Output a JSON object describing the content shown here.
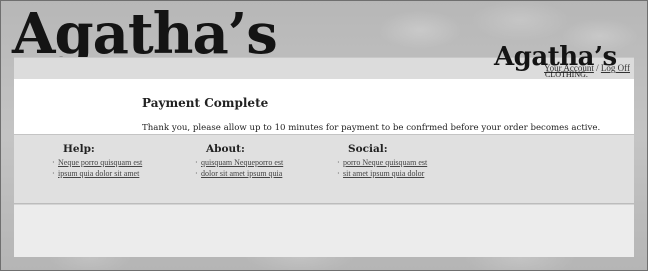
{
  "brand": {
    "name": "Agatha’s",
    "subtitle": "CLOTHING."
  },
  "account": {
    "your_account_label": "Your Account",
    "separator": "/",
    "log_off_label": "Log Off"
  },
  "content": {
    "title": "Payment Complete",
    "message": "Thank you, please allow up to 10 minutes for payment to be confrmed before your order becomes active."
  },
  "footer": {
    "columns": [
      {
        "title": "Help:",
        "links": [
          "Neque porro quisquam est",
          "ipsum quia dolor sit amet"
        ]
      },
      {
        "title": "About:",
        "links": [
          "quisquam Nequeporro est",
          "dolor sit amet ipsum quia"
        ]
      },
      {
        "title": "Social:",
        "links": [
          "porro Neque quisquam est",
          "sit amet ipsum quia dolor"
        ]
      }
    ],
    "bullet": "·"
  }
}
